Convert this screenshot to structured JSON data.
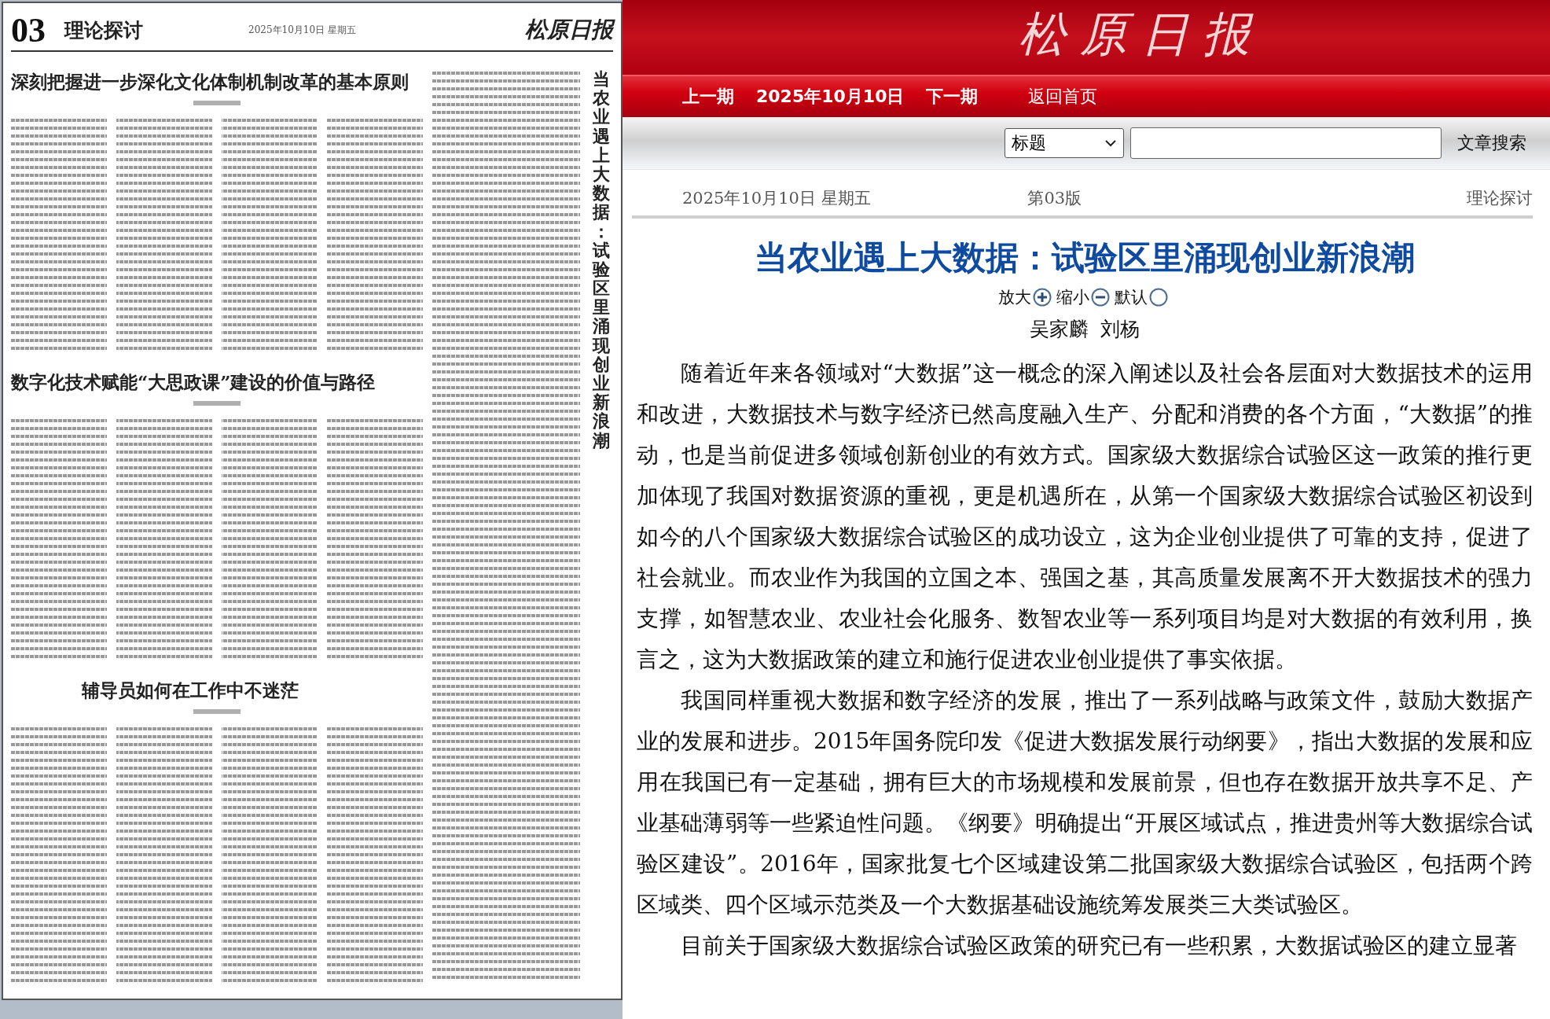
{
  "newspaper_page": {
    "page_number": "03",
    "section": "理论探讨",
    "date_line": "2025年10月10日 星期五",
    "logo": "松原日报",
    "articles": [
      {
        "headline": "深刻把握进一步深化文化体制机制改革的基本原则"
      },
      {
        "headline": "数字化技术赋能“大思政课”建设的价值与路径"
      },
      {
        "headline": "辅导员如何在工作中不迷茫"
      }
    ],
    "side_headline": "当农业遇上大数据：试验区里涌现创业新浪潮"
  },
  "masthead": {
    "logo": "松原日报"
  },
  "nav": {
    "previous": "上一期",
    "date": "2025年10月10日",
    "next": "下一期",
    "home": "返回首页"
  },
  "search": {
    "field_option": "标题",
    "button": "文章搜索"
  },
  "dateline": {
    "date": "2025年10月10日 星期五",
    "edition": "第03版",
    "section": "理论探讨"
  },
  "article": {
    "title": "当农业遇上大数据：试验区里涌现创业新浪潮",
    "font_controls": [
      {
        "label": "放大",
        "kind": "plus"
      },
      {
        "label": "缩小",
        "kind": "minus"
      },
      {
        "label": "默认",
        "kind": "reset"
      }
    ],
    "authors": "吴家麟  刘杨",
    "paragraphs": [
      "随着近年来各领域对“大数据”这一概念的深入阐述以及社会各层面对大数据技术的运用和改进，大数据技术与数字经济已然高度融入生产、分配和消费的各个方面，“大数据”的推动，也是当前促进多领域创新创业的有效方式。国家级大数据综合试验区这一政策的推行更加体现了我国对数据资源的重视，更是机遇所在，从第一个国家级大数据综合试验区初设到如今的八个国家级大数据综合试验区的成功设立，这为企业创业提供了可靠的支持，促进了社会就业。而农业作为我国的立国之本、强国之基，其高质量发展离不开大数据技术的强力支撑，如智慧农业、农业社会化服务、数智农业等一系列项目均是对大数据的有效利用，换言之，这为大数据政策的建立和施行促进农业创业提供了事实依据。",
      "我国同样重视大数据和数字经济的发展，推出了一系列战略与政策文件，鼓励大数据产业的发展和进步。2015年国务院印发《促进大数据发展行动纲要》，指出大数据的发展和应用在我国已有一定基础，拥有巨大的市场规模和发展前景，但也存在数据开放共享不足、产业基础薄弱等一些紧迫性问题。《纲要》明确提出“开展区域试点，推进贵州等大数据综合试验区建设”。2016年，国家批复七个区域建设第二批国家级大数据综合试验区，包括两个跨区域类、四个区域示范类及一个大数据基础设施统筹发展类三大类试验区。",
      "目前关于国家级大数据综合试验区政策的研究已有一些积累，大数据试验区的建立显著"
    ]
  }
}
